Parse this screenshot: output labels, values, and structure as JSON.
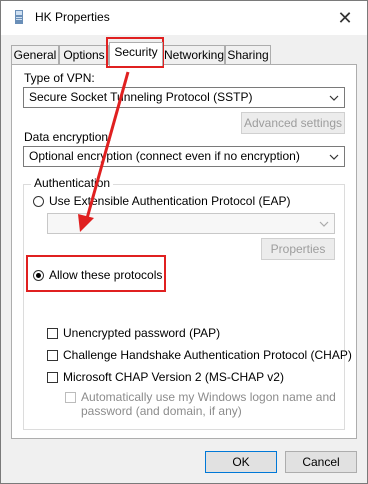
{
  "window": {
    "title": "HK Properties",
    "close_glyph": "✕"
  },
  "tabs": [
    {
      "label": "General"
    },
    {
      "label": "Options"
    },
    {
      "label": "Security"
    },
    {
      "label": "Networking"
    },
    {
      "label": "Sharing"
    }
  ],
  "security": {
    "vpn_type_label": "Type of VPN:",
    "vpn_type_value": "Secure Socket Tunneling Protocol (SSTP)",
    "advanced_label": "Advanced settings",
    "encryption_label": "Data encryption:",
    "encryption_value": "Optional encryption (connect even if no encryption)",
    "auth_group_label": "Authentication",
    "eap_radio_label": "Use Extensible Authentication Protocol (EAP)",
    "eap_dropdown_value": "",
    "properties_label": "Properties",
    "allow_radio_label": "Allow these protocols",
    "protocols": [
      {
        "label": "Unencrypted password (PAP)",
        "checked": false
      },
      {
        "label": "Challenge Handshake Authentication Protocol (CHAP)",
        "checked": false
      },
      {
        "label": "Microsoft CHAP Version 2 (MS-CHAP v2)",
        "checked": false
      }
    ],
    "auto_logon_label_line1": "Automatically use my Windows logon name and",
    "auto_logon_label_line2": "password (and domain, if any)"
  },
  "footer": {
    "ok_label": "OK",
    "cancel_label": "Cancel"
  },
  "colors": {
    "annotation": "#e02020",
    "accent": "#0078d7"
  },
  "icons": {
    "title": "vpn-connection-icon",
    "dropdown": "chevron-down-icon"
  }
}
